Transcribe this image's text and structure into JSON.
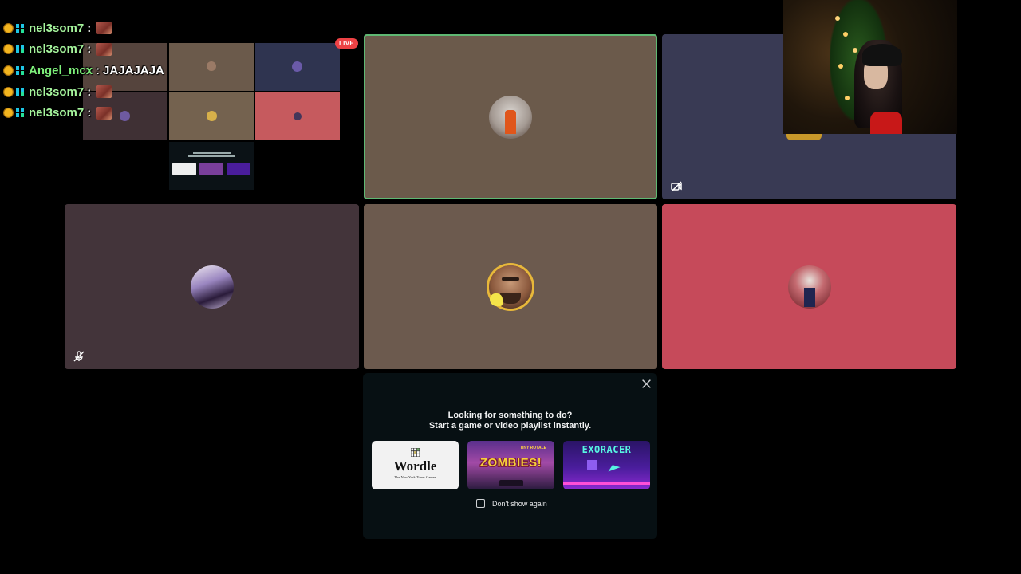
{
  "chat": [
    {
      "user": "nel3som7",
      "separator": ":",
      "message": "",
      "has_emote": true,
      "user_color": "#a6f59d"
    },
    {
      "user": "nel3som7",
      "separator": ":",
      "message": "",
      "has_emote": true,
      "user_color": "#a6f59d"
    },
    {
      "user": "Angel_mcx",
      "separator": ":",
      "message": "JAJAJAJA",
      "has_emote": false,
      "user_color": "#7df07a"
    },
    {
      "user": "nel3som7",
      "separator": ":",
      "message": "",
      "has_emote": true,
      "user_color": "#a6f59d"
    },
    {
      "user": "nel3som7",
      "separator": ":",
      "message": "",
      "has_emote": true,
      "user_color": "#a6f59d"
    }
  ],
  "stream": {
    "live_label": "LIVE"
  },
  "tiles": {
    "colors": {
      "top_center": "#6b5a4b",
      "top_right": "#393a54",
      "bottom_left": "#43343a",
      "bottom_center": "#6c5a4e",
      "bottom_right": "#c64a5a"
    }
  },
  "activity": {
    "title_line1": "Looking for something to do?",
    "title_line2": "Start a game or video playlist instantly.",
    "games": [
      {
        "name": "Wordle",
        "publisher": "The New York Times Games"
      },
      {
        "name": "ZOMBIES!",
        "subtitle": "TINY ROYALE"
      },
      {
        "name": "EXORACER"
      }
    ],
    "dont_show_label": "Don't show again"
  },
  "icons": {
    "close": "close-icon",
    "mute": "mic-muted-icon",
    "video_off": "camera-off-icon"
  }
}
